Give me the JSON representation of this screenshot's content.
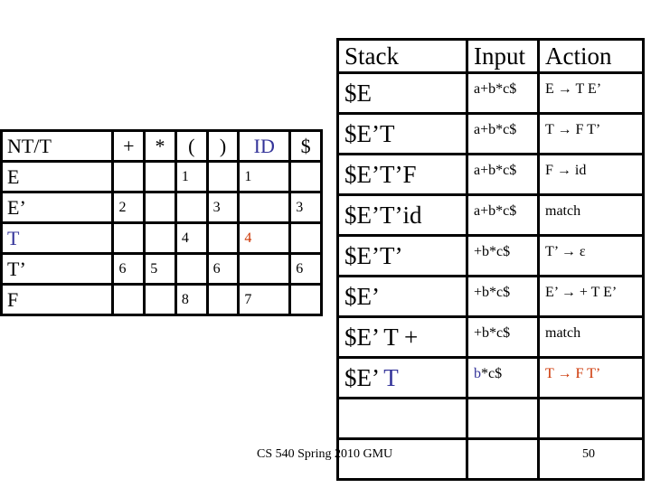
{
  "parse_table": {
    "headers": [
      "NT/T",
      "+",
      "*",
      "(",
      ")",
      "ID",
      "$"
    ],
    "header_colors": {
      "ID": "#333399"
    },
    "rows": [
      {
        "nt": "E",
        "cells": [
          "",
          "",
          "1",
          "",
          "1",
          ""
        ]
      },
      {
        "nt": "E’",
        "cells": [
          "2",
          "",
          "",
          "3",
          "",
          "3"
        ]
      },
      {
        "nt": "T",
        "cells": [
          "",
          "",
          "4",
          "",
          "4",
          ""
        ],
        "nt_color": "#333399",
        "highlight_col": 4,
        "highlight_color": "#cc3300"
      },
      {
        "nt": "T’",
        "cells": [
          "6",
          "5",
          "",
          "6",
          "",
          "6"
        ]
      },
      {
        "nt": "F",
        "cells": [
          "",
          "",
          "8",
          "",
          "7",
          ""
        ]
      }
    ]
  },
  "trace_table": {
    "headers": {
      "stack": "Stack",
      "input": "Input",
      "action": "Action"
    },
    "rows": [
      {
        "stack": "$E",
        "input": "a+b*c$",
        "action": "E → T E’"
      },
      {
        "stack": "$E’T",
        "input": "a+b*c$",
        "action": "T → F T’"
      },
      {
        "stack": "$E’T’F",
        "input": "a+b*c$",
        "action": "F → id"
      },
      {
        "stack": "$E’T’id",
        "input": "a+b*c$",
        "action": "match"
      },
      {
        "stack": "$E’T’",
        "input": "+b*c$",
        "action": "T’ → ε"
      },
      {
        "stack": "$E’",
        "input": "+b*c$",
        "action": "E’ → + T E’"
      },
      {
        "stack": "$E’ T +",
        "input": "+b*c$",
        "action": "match"
      },
      {
        "stack_prefix": "$E’ ",
        "stack_highlight": "T",
        "input_highlight": "b",
        "input_rest": "*c$",
        "action": "T → F T’",
        "highlight_color": "#333399",
        "action_color": "#cc3300"
      },
      {
        "stack": "",
        "input": "",
        "action": ""
      },
      {
        "stack": "",
        "input": "",
        "action": ""
      }
    ]
  },
  "footer": {
    "course": "CS 540 Spring 2010 GMU",
    "page": "50"
  },
  "colors": {
    "blue": "#333399",
    "red": "#cc3300"
  }
}
